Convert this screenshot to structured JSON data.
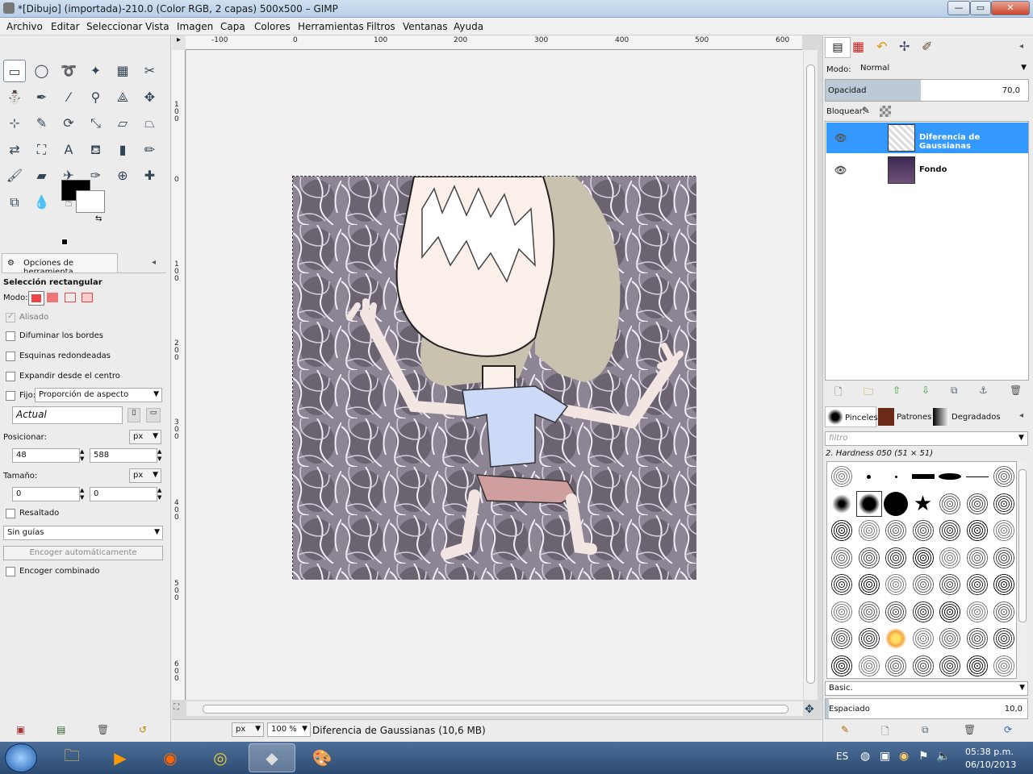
{
  "window": {
    "title": "*[Dibujo] (importada)-210.0 (Color RGB, 2 capas) 500x500 – GIMP",
    "minimize": "—",
    "maximize": "▭",
    "close": "✕"
  },
  "menu": [
    "Archivo",
    "Editar",
    "Seleccionar",
    "Vista",
    "Imagen",
    "Capa",
    "Colores",
    "Herramientas",
    "Filtros",
    "Ventanas",
    "Ayuda"
  ],
  "toolbox": {
    "tools": [
      {
        "name": "rect-select",
        "glyph": "▭"
      },
      {
        "name": "ellipse-select",
        "glyph": "◯"
      },
      {
        "name": "free-select",
        "glyph": "➰"
      },
      {
        "name": "fuzzy-select",
        "glyph": "✦"
      },
      {
        "name": "color-select",
        "glyph": "▦"
      },
      {
        "name": "scissors",
        "glyph": "✂"
      },
      {
        "name": "foreground-select",
        "glyph": "⛄"
      },
      {
        "name": "paths",
        "glyph": "✒"
      },
      {
        "name": "color-picker",
        "glyph": "⁄"
      },
      {
        "name": "zoom",
        "glyph": "⚲"
      },
      {
        "name": "measure",
        "glyph": "⟁"
      },
      {
        "name": "move",
        "glyph": "✥"
      },
      {
        "name": "align",
        "glyph": "⊹"
      },
      {
        "name": "crop",
        "glyph": "✎"
      },
      {
        "name": "rotate",
        "glyph": "⟳"
      },
      {
        "name": "scale",
        "glyph": "⤡"
      },
      {
        "name": "shear",
        "glyph": "▱"
      },
      {
        "name": "perspective",
        "glyph": "⏢"
      },
      {
        "name": "flip",
        "glyph": "⇄"
      },
      {
        "name": "cage",
        "glyph": "⛶"
      },
      {
        "name": "text",
        "glyph": "A"
      },
      {
        "name": "bucket-fill",
        "glyph": "⛾"
      },
      {
        "name": "blend",
        "glyph": "▮"
      },
      {
        "name": "pencil",
        "glyph": "✏"
      },
      {
        "name": "paintbrush",
        "glyph": "🖌"
      },
      {
        "name": "eraser",
        "glyph": "▰"
      },
      {
        "name": "airbrush",
        "glyph": "✈"
      },
      {
        "name": "ink",
        "glyph": "✑"
      },
      {
        "name": "clone",
        "glyph": "⊕"
      },
      {
        "name": "heal",
        "glyph": "✚"
      },
      {
        "name": "perspective-clone",
        "glyph": "⧉"
      },
      {
        "name": "blur",
        "glyph": "💧"
      },
      {
        "name": "smudge",
        "glyph": "☝"
      },
      {
        "name": "dodge-burn",
        "glyph": "◐"
      }
    ]
  },
  "tool_options": {
    "tab_label": "Opciones de herramienta",
    "heading": "Selección rectangular",
    "mode_label": "Modo:",
    "antialias": "Alisado",
    "feather": "Difuminar los bordes",
    "rounded": "Esquinas redondeadas",
    "expand_center": "Expandir desde el centro",
    "fixed_label": "Fijo:",
    "fixed_value": "Proporción de aspecto",
    "current": "Actual",
    "position_label": "Posicionar:",
    "pos_x": "48",
    "pos_y": "588",
    "size_label": "Tamaño:",
    "size_w": "0",
    "size_h": "0",
    "unit": "px",
    "highlight": "Resaltado",
    "guides": "Sin guías",
    "autoshrink": "Encoger automáticamente",
    "shrink_merged": "Encoger combinado"
  },
  "rulers": {
    "h": [
      "-100",
      "0",
      "100",
      "200",
      "300",
      "400",
      "500",
      "600"
    ],
    "v": [
      "1\n0\n0",
      "0",
      "1\n0\n0",
      "2\n0\n0",
      "3\n0\n0",
      "4\n0\n0",
      "5\n0\n0",
      "6\n0\n0"
    ]
  },
  "status": {
    "unit": "px",
    "zoom": "100 %",
    "info": "Diferencia de Gaussianas (10,6 MB)"
  },
  "layers": {
    "mode_label": "Modo:",
    "mode_value": "Normal",
    "opacity_label": "Opacidad",
    "opacity_value": "70,0",
    "opacity_fraction": 0.7,
    "lock_label": "Bloquear:",
    "items": [
      {
        "name": "Diferencia de Gaussianas",
        "selected": true
      },
      {
        "name": "Fondo",
        "selected": false
      }
    ]
  },
  "brushes": {
    "tabs": [
      "Pinceles",
      "Patrones",
      "Degradados"
    ],
    "filter_placeholder": "filtro",
    "current": "2. Hardness 050 (51 × 51)",
    "preset": "Basic.",
    "spacing_label": "Espaciado",
    "spacing_value": "10,0"
  },
  "taskbar": {
    "lang": "ES",
    "time": "05:38 p.m.",
    "date": "06/10/2013"
  }
}
